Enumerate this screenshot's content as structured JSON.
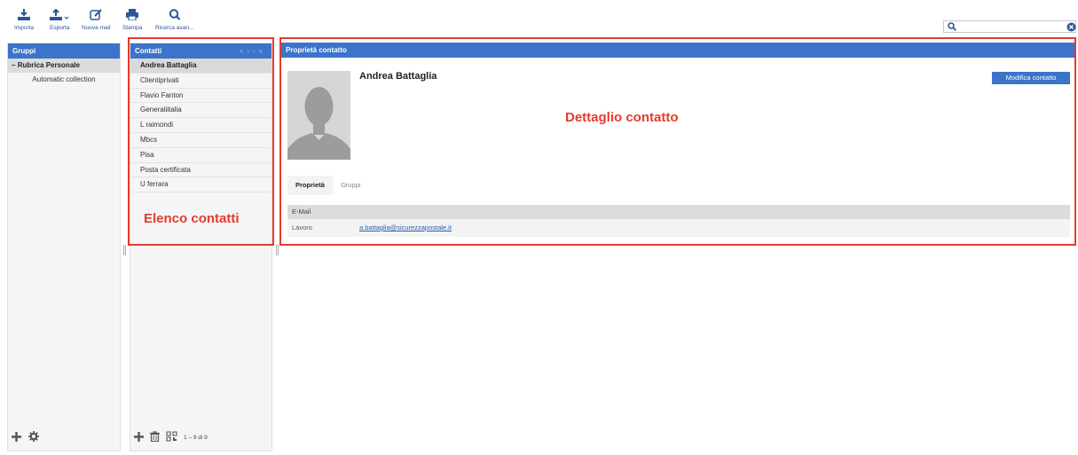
{
  "toolbar": {
    "import_label": "Importa",
    "export_label": "Esporta",
    "newmail_label": "Nuova mail",
    "print_label": "Stampa",
    "advsearch_label": "Ricerca avan..."
  },
  "search": {
    "placeholder": "",
    "value": ""
  },
  "groups": {
    "title": "Gruppi",
    "root": "Rubrica Personale",
    "children": [
      "Automatic collection"
    ]
  },
  "contacts": {
    "title": "Contatti",
    "items": [
      "Andrea Battaglia",
      "Clientiprivati",
      "Flavio Fanton",
      "Generaliitalia",
      "L raimondi",
      "Mbcs",
      "Pisa",
      "Posta certificata",
      "U ferrara"
    ],
    "selected_index": 0,
    "count_label": "1 – 9 di 9"
  },
  "detail": {
    "title": "Proprietà contatto",
    "contact_name": "Andrea Battaglia",
    "edit_label": "Modifica contatto",
    "tabs": [
      "Proprietà",
      "Gruppi"
    ],
    "section_label": "E-Mail",
    "email_type": "Lavoro",
    "email_value": "a.battaglia@sicurezzapostale.it"
  },
  "annotations": {
    "contacts_list": "Elenco contatti",
    "contact_detail": "Dettaglio contatto"
  },
  "colors": {
    "accent": "#3b74c9",
    "annotation": "#e53b2e"
  }
}
